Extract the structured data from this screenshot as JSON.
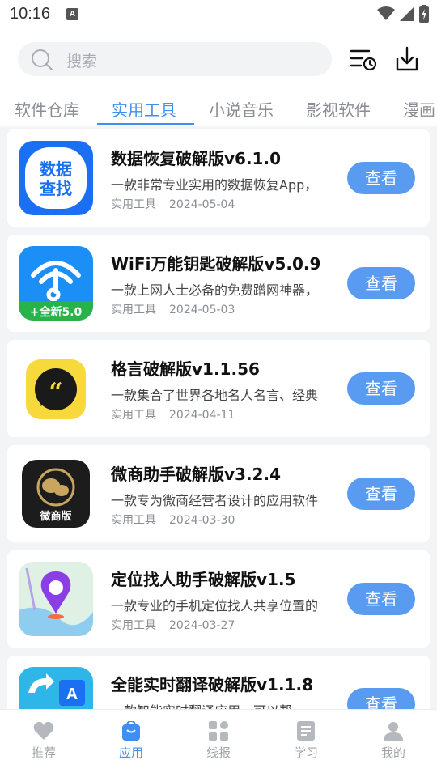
{
  "status_bar": {
    "time": "10:16"
  },
  "search": {
    "placeholder": "搜索"
  },
  "tabs": [
    {
      "label": "软件仓库",
      "active": false
    },
    {
      "label": "实用工具",
      "active": true
    },
    {
      "label": "小说音乐",
      "active": false
    },
    {
      "label": "影视软件",
      "active": false
    },
    {
      "label": "漫画",
      "active": false
    }
  ],
  "apps": [
    {
      "title": "数据恢复破解版v6.1.0",
      "desc": "一款非常专业实用的数据恢复App，",
      "category": "实用工具",
      "date": "2024-05-04",
      "button": "查看",
      "icon_text": "数据\n查找",
      "icon": "data-recovery-icon"
    },
    {
      "title": "WiFi万能钥匙破解版v5.0.9",
      "desc": "一款上网人士必备的免费蹭网神器，",
      "category": "实用工具",
      "date": "2024-05-03",
      "button": "查看",
      "icon_text": "+全新5.0",
      "icon": "wifi-key-icon"
    },
    {
      "title": "格言破解版v1.1.56",
      "desc": "一款集合了世界各地名人名言、经典",
      "category": "实用工具",
      "date": "2024-04-11",
      "button": "查看",
      "icon": "quote-bubble-icon"
    },
    {
      "title": "微商助手破解版v3.2.4",
      "desc": "一款专为微商经营者设计的应用软件",
      "category": "实用工具",
      "date": "2024-03-30",
      "button": "查看",
      "icon_text": "微商版",
      "icon": "wechat-business-icon"
    },
    {
      "title": "定位找人助手破解版v1.5",
      "desc": "一款专业的手机定位找人共享位置的",
      "category": "实用工具",
      "date": "2024-03-27",
      "button": "查看",
      "icon": "location-pin-icon"
    },
    {
      "title": "全能实时翻译破解版v1.1.8",
      "desc": "一款智能实时翻译应用，可以帮",
      "category": "",
      "date": "",
      "button": "查看",
      "icon": "translate-icon"
    }
  ],
  "bottom_nav": [
    {
      "label": "推荐",
      "active": false,
      "icon": "heart-icon"
    },
    {
      "label": "应用",
      "active": true,
      "icon": "bag-icon"
    },
    {
      "label": "线报",
      "active": false,
      "icon": "grid-icon"
    },
    {
      "label": "学习",
      "active": false,
      "icon": "book-icon"
    },
    {
      "label": "我的",
      "active": false,
      "icon": "user-icon"
    }
  ],
  "colors": {
    "accent": "#3f8ef0",
    "button": "#5a9bf2"
  }
}
